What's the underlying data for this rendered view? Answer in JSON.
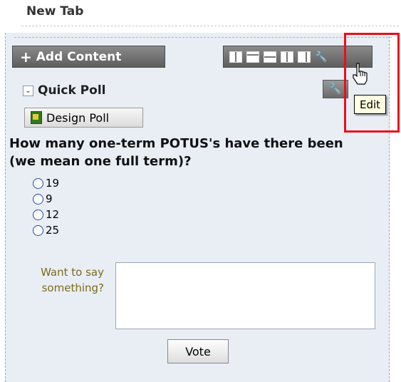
{
  "tab": {
    "title": "New Tab"
  },
  "toolbar": {
    "add_content_label": "Add Content",
    "layout_icons": [
      "layout-three-col-icon",
      "layout-top-band-icon",
      "layout-two-row-icon",
      "layout-two-col-icon",
      "layout-right-col-icon"
    ],
    "edit_icon": "wrench-icon"
  },
  "tooltip": {
    "text": "Edit"
  },
  "portlet": {
    "title": "Quick Poll",
    "design_button_label": "Design Poll",
    "question": "How many one-term POTUS's have there been (we mean one full term)?",
    "options": [
      "19",
      "9",
      "12",
      "25"
    ],
    "comment_label": "Want to say something?",
    "vote_label": "Vote"
  },
  "colors": {
    "highlight": "#e8101b",
    "panel_bg": "#e9eef5",
    "label_color": "#7b6b1b"
  }
}
